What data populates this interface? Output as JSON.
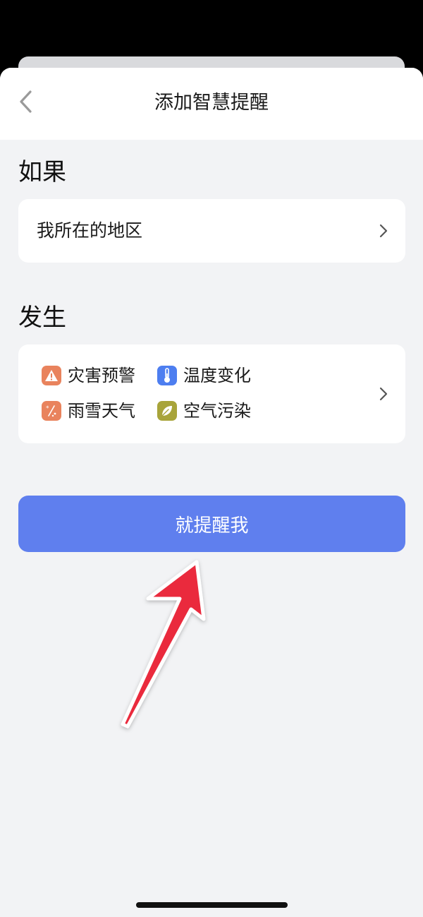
{
  "header": {
    "title": "添加智慧提醒"
  },
  "condition": {
    "heading": "如果",
    "location_label": "我所在的地区"
  },
  "events": {
    "heading": "发生",
    "items": [
      {
        "label": "灾害预警",
        "icon": "warning-icon",
        "color": "#e9835d"
      },
      {
        "label": "温度变化",
        "icon": "thermometer-icon",
        "color": "#4d7ef0"
      },
      {
        "label": "雨雪天气",
        "icon": "rain-snow-icon",
        "color": "#e9835d"
      },
      {
        "label": "空气污染",
        "icon": "leaf-icon",
        "color": "#a8a43a"
      }
    ]
  },
  "actions": {
    "submit_label": "就提醒我"
  },
  "colors": {
    "primary_button": "#5f7fee",
    "background": "#f2f3f5",
    "annotation_arrow": "#ea2a3c"
  }
}
